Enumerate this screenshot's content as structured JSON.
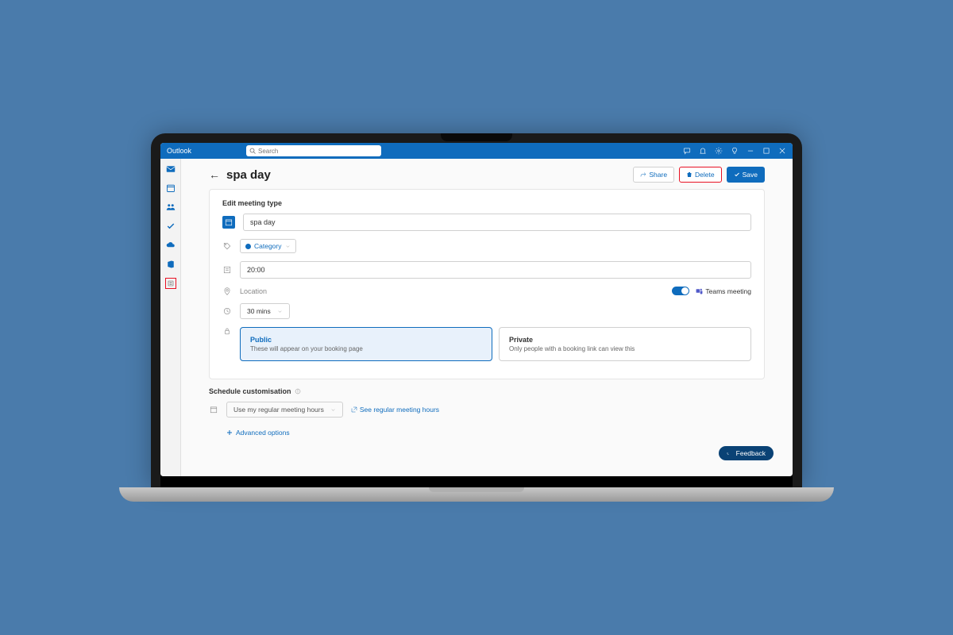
{
  "titlebar": {
    "app": "Outlook",
    "search_placeholder": "Search"
  },
  "header": {
    "title": "spa day",
    "share": "Share",
    "delete": "Delete",
    "save": "Save"
  },
  "form": {
    "section": "Edit meeting type",
    "name": "spa day",
    "category": "Category",
    "time": "20:00",
    "location_placeholder": "Location",
    "teams_label": "Teams meeting",
    "duration": "30 mins",
    "visibility": {
      "public_title": "Public",
      "public_desc": "These will appear on your booking page",
      "private_title": "Private",
      "private_desc": "Only people with a booking link can view this"
    }
  },
  "schedule": {
    "section": "Schedule customisation",
    "select": "Use my regular meeting hours",
    "link": "See regular meeting hours",
    "advanced": "Advanced options"
  },
  "feedback": "Feedback"
}
